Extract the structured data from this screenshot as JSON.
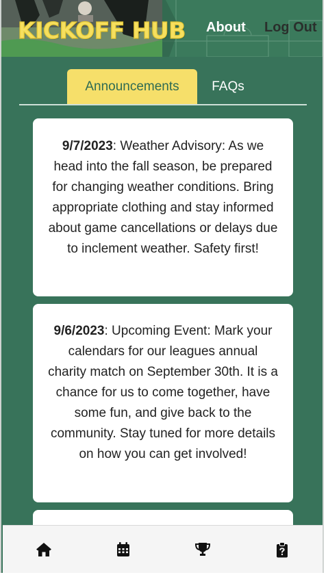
{
  "header": {
    "logo_text": "KICKOFF HUB",
    "nav": {
      "about_label": "About",
      "logout_label": "Log Out"
    }
  },
  "tabs": {
    "announcements_label": "Announcements",
    "faqs_label": "FAQs",
    "active": "Announcements"
  },
  "announcements": [
    {
      "date": "9/7/2023",
      "text": ": Weather Advisory: As we head into the fall season, be prepared for changing weather conditions. Bring appropriate clothing and stay informed about game cancellations or delays due to inclement weather. Safety first!"
    },
    {
      "date": "9/6/2023",
      "text": ": Upcoming Event: Mark your calendars for our leagues annual charity match on September 30th. It is a chance for us to come together, have some fun, and give back to the community. Stay tuned for more details on how you can get involved!"
    }
  ],
  "bottom_nav": {
    "items": [
      {
        "icon": "home-icon"
      },
      {
        "icon": "calendar-icon"
      },
      {
        "icon": "trophy-icon"
      },
      {
        "icon": "clipboard-question-icon"
      }
    ]
  },
  "colors": {
    "brand_green": "#38735a",
    "accent_yellow": "#f6df6a",
    "logo_yellow": "#f6df5f"
  }
}
